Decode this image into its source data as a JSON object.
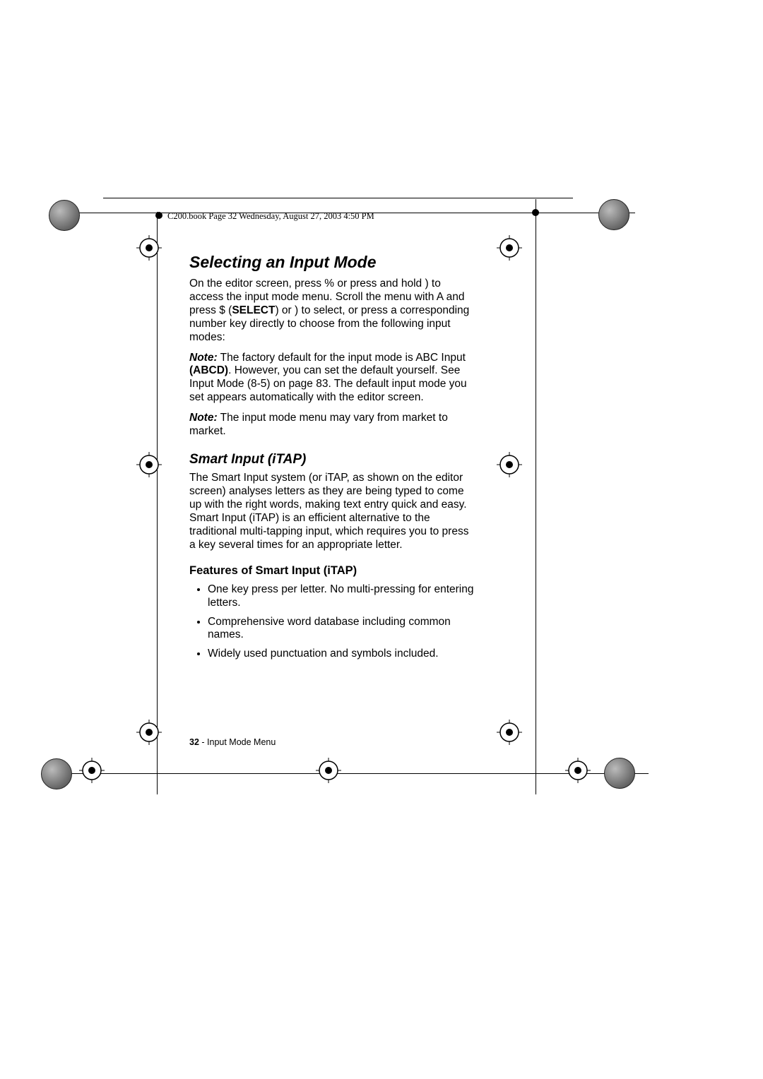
{
  "header": {
    "text": "C200.book  Page 32  Wednesday, August 27, 2003  4:50 PM"
  },
  "section": {
    "title": "Selecting an Input Mode",
    "p1_a": "On the editor screen, press ",
    "p1_b": " or press and hold ",
    "p1_c": " to access the input mode menu. Scroll the menu with ",
    "p1_d": " and press ",
    "p1_e": " (",
    "p1_select": "SELECT",
    "p1_f": ") or ",
    "p1_g": " to select, or press a corresponding number key directly to choose from the following input modes:",
    "key1": "%",
    "key2": ")",
    "key3": "A",
    "key4": "$",
    "key5": ")",
    "note1_label": "Note:",
    "note1_a": " The factory default for the input mode is ",
    "note1_mode": "ABC Input",
    "note1_glyph": " (ABCD)",
    "note1_b": ". However, you can set the default yourself. See  Input Mode (8-5) on page 83. The default input mode you set appears automatically with the editor screen.",
    "note2_label": "Note:",
    "note2_a": " The input mode menu may vary from market to market."
  },
  "smart": {
    "title": "Smart Input (iTAP)",
    "p1_a": "The ",
    "p1_b": "Smart Input",
    "p1_c": " system (or ",
    "p1_d": "iTAP",
    "p1_e": ", as shown on the editor screen) analyses letters as they are being typed to come up with the right words, making text entry quick and easy. ",
    "p1_f": "Smart Input",
    "p1_g": " (",
    "p1_h": "iTAP",
    "p1_i": ") is an efficient alternative to the traditional multi-tapping input, which requires you to press a key several times for an appropriate letter.",
    "features_title": "Features of Smart Input (iTAP)",
    "features": [
      "One key press per letter. No multi-pressing for entering letters.",
      "Comprehensive word database including common names.",
      "Widely used punctuation and symbols included."
    ]
  },
  "footer": {
    "page_number": "32",
    "sep": " - ",
    "title": "Input Mode Menu"
  }
}
